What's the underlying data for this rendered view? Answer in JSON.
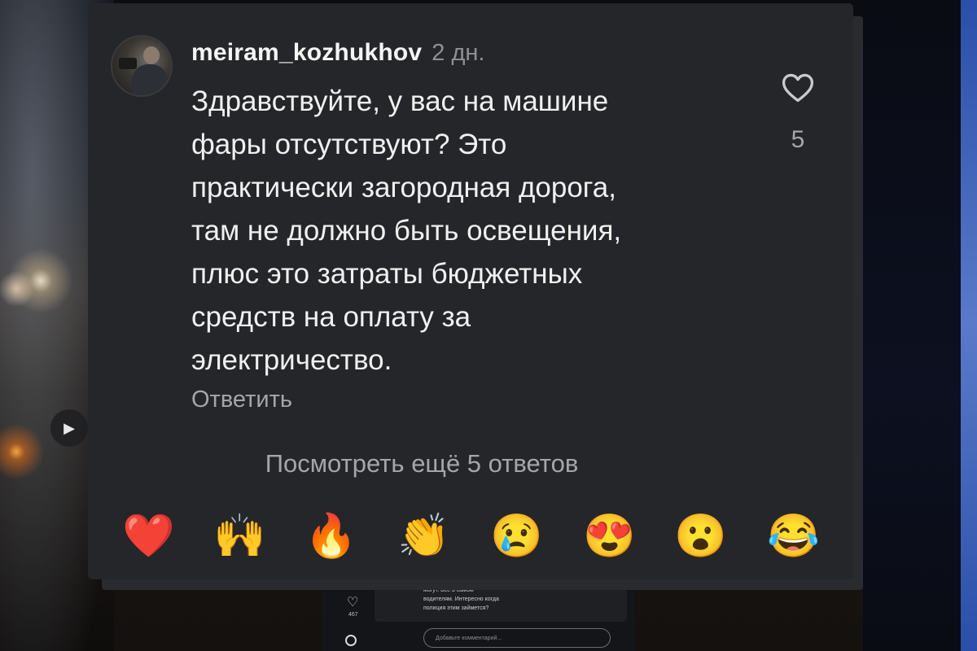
{
  "comment": {
    "username": "meiram_kozhukhov",
    "time": "2 дн.",
    "lines": [
      "Здравствуйте, у вас на машине",
      "фары отсутствуют? Это",
      "практически загородная дорога,",
      "там не должно быть освещения,",
      "плюс это затраты бюджетных",
      "средств на оплату за",
      "электричество."
    ],
    "reply_label": "Ответить",
    "like_count": "5",
    "like_icon": "heart-outline-icon",
    "more_replies_label": "Посмотреть ещё 5 ответов"
  },
  "reactions": [
    {
      "name": "red-heart",
      "glyph": "❤️"
    },
    {
      "name": "raising-hands",
      "glyph": "🙌"
    },
    {
      "name": "fire",
      "glyph": "🔥"
    },
    {
      "name": "clapping-hands",
      "glyph": "👏"
    },
    {
      "name": "crying-face",
      "glyph": "😢"
    },
    {
      "name": "heart-eyes",
      "glyph": "😍"
    },
    {
      "name": "surprised-face",
      "glyph": "😮"
    },
    {
      "name": "tears-of-joy",
      "glyph": "😂"
    }
  ],
  "background": {
    "play_icon": "play-icon",
    "under_comment_lines": [
      "могут. Все в самом",
      "водителям. Интересно когда",
      "полиция этим займется?"
    ],
    "under_like_count": "467",
    "under_input_placeholder": "Добавьте комментарий..."
  }
}
